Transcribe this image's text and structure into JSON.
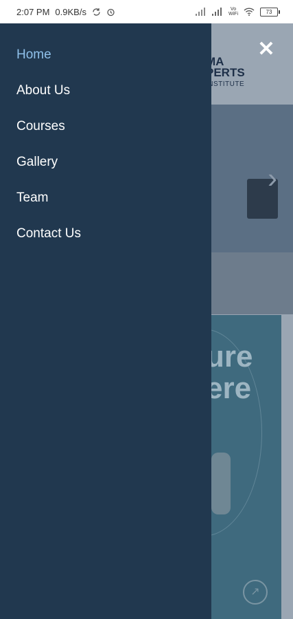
{
  "status_bar": {
    "time": "2:07 PM",
    "net_speed": "0.9KB/s",
    "icons": [
      "sync-icon",
      "alarm-icon",
      "signal-icon",
      "signal-icon",
      "volte-icon",
      "wifi-icon",
      "battery-icon"
    ],
    "volte_label": "Vo\nWiFi",
    "battery": "73"
  },
  "background": {
    "brand_line1": "MA",
    "brand_line2": "PERTS",
    "brand_line3": "INSTITUTE",
    "banner_text_line1": "ure",
    "banner_text_line2": "ere"
  },
  "drawer": {
    "items": [
      {
        "label": "Home",
        "active": true
      },
      {
        "label": "About Us",
        "active": false
      },
      {
        "label": "Courses",
        "active": false
      },
      {
        "label": "Gallery",
        "active": false
      },
      {
        "label": "Team",
        "active": false
      },
      {
        "label": "Contact Us",
        "active": false
      }
    ]
  },
  "colors": {
    "drawer_bg": "#21384f",
    "active_item": "#8fc0ea",
    "menu_text": "#ffffff"
  }
}
